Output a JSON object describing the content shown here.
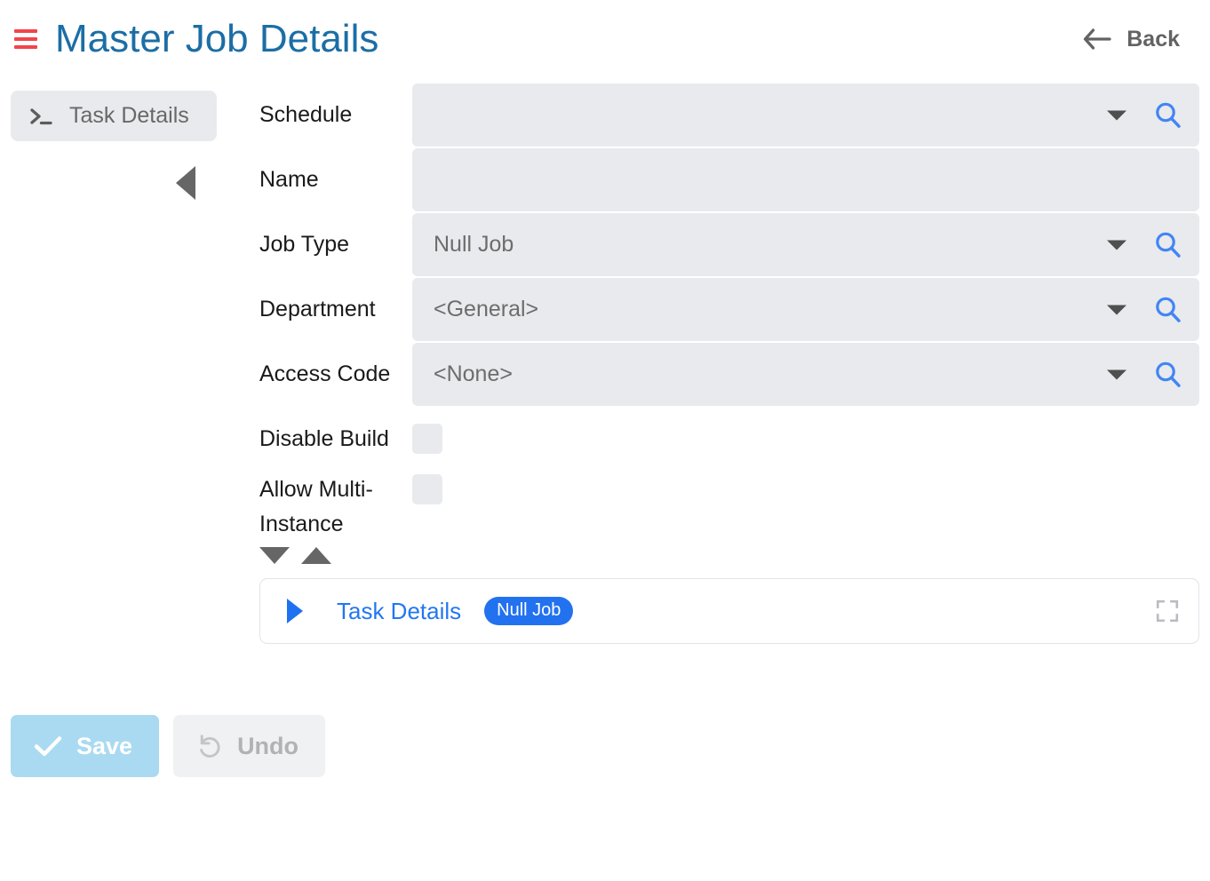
{
  "header": {
    "menu_icon": "hamburger-icon",
    "title": "Master Job Details",
    "back_label": "Back",
    "back_icon": "arrow-left-icon",
    "title_color": "#1b6ea5",
    "menu_color": "#f4434a"
  },
  "left_rail": {
    "tab_label": "Task Details",
    "tab_icon": "terminal-icon",
    "collapse_icon": "triangle-left-icon"
  },
  "form": {
    "fields": [
      {
        "label": "Schedule",
        "value": "",
        "type": "lookup",
        "has_caret": true,
        "has_search": true
      },
      {
        "label": "Name",
        "value": "",
        "type": "text",
        "has_caret": false,
        "has_search": false
      },
      {
        "label": "Job Type",
        "value": "Null Job",
        "type": "lookup",
        "has_caret": true,
        "has_search": true
      },
      {
        "label": "Department",
        "value": "<General>",
        "type": "lookup",
        "has_caret": true,
        "has_search": true
      },
      {
        "label": "Access Code",
        "value": "<None>",
        "type": "lookup",
        "has_caret": true,
        "has_search": true
      },
      {
        "label": "Disable Build",
        "value": "",
        "type": "checkbox",
        "checked": false
      },
      {
        "label": "Allow Multi-Instance",
        "value": "",
        "type": "checkbox",
        "checked": false
      }
    ],
    "collapse_all_icon": "triangle-down-icon",
    "expand_all_icon": "triangle-up-icon"
  },
  "task_panel": {
    "expander_icon": "triangle-right-icon",
    "title": "Task Details",
    "badge": "Null Job",
    "badge_color": "#2272ef",
    "fullscreen_icon": "fullscreen-icon"
  },
  "footer": {
    "save_label": "Save",
    "save_icon": "check-icon",
    "save_color": "#a9daf1",
    "undo_label": "Undo",
    "undo_icon": "undo-icon",
    "undo_color": "#f0f1f3"
  }
}
